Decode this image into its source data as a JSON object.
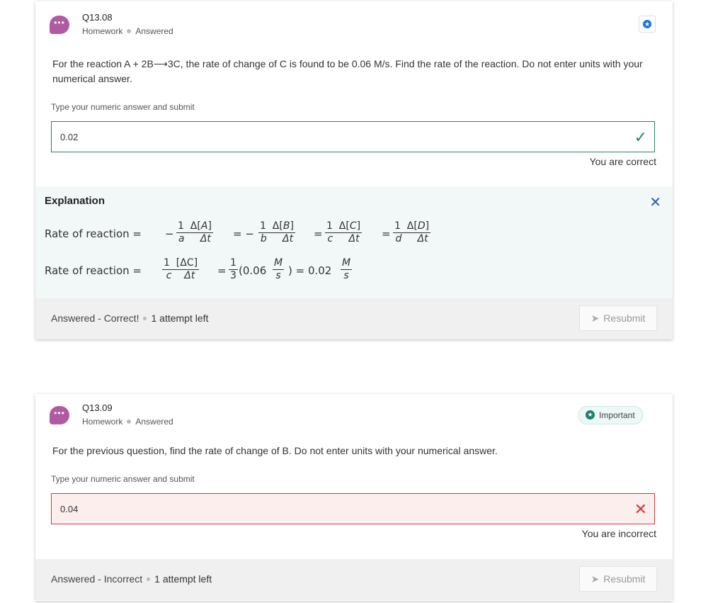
{
  "q1": {
    "id": "Q13.08",
    "meta_type": "Homework",
    "meta_status": "Answered",
    "question": "For the reaction A + 2B⟶3C, the rate of change of C is found to be 0.06 M/s. Find the rate of the reaction. Do not enter units with your numerical answer.",
    "prompt": "Type your numeric answer and submit",
    "answer": "0.02",
    "feedback": "You are correct",
    "explanation_title": "Explanation",
    "eq1_label": "Rate of reaction  =",
    "eq2_label": "Rate of reaction  =",
    "footer_status": "Answered - Correct!",
    "attempts": "1 attempt left",
    "resubmit": "Resubmit"
  },
  "q2": {
    "id": "Q13.09",
    "meta_type": "Homework",
    "meta_status": "Answered",
    "important": "Important",
    "question": "For the previous question, find the rate of change of B. Do not enter units with your numerical answer.",
    "prompt": "Type your numeric answer and submit",
    "answer": "0.04",
    "feedback": "You are incorrect",
    "footer_status": "Answered - Incorrect",
    "attempts": "1 attempt left",
    "resubmit": "Resubmit"
  },
  "icons": {
    "avatar": "chat-bubble-icon",
    "star": "star-icon",
    "check": "checkmark-icon",
    "cross": "x-mark-icon",
    "close": "close-icon",
    "send": "paper-plane-icon"
  },
  "colors": {
    "avatar": "#b05aa2",
    "correct": "#1d8a5c",
    "incorrect": "#d33a3a",
    "star": "#1a73e8",
    "important": "#1d7f6e",
    "explanation_bg": "#f2f8f7"
  }
}
